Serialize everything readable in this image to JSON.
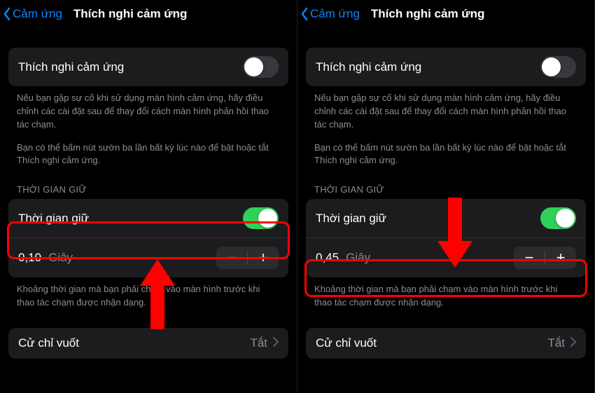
{
  "left": {
    "back_label": "Cảm ứng",
    "title": "Thích nghi cảm ứng",
    "touch_accom": {
      "label": "Thích nghi cảm ứng",
      "on": false
    },
    "desc1": "Nếu bạn gặp sự cố khi sử dụng màn hình cảm ứng, hãy điều chỉnh các cài đặt sau để thay đổi cách màn hình phản hồi thao tác chạm.",
    "desc2": "Bạn có thể bấm nút sườn ba lần bất kỳ lúc nào để bật hoặc tắt Thích nghi cảm ứng.",
    "hold_header": "THỜI GIAN GIỮ",
    "hold": {
      "label": "Thời gian giữ",
      "on": true,
      "value": "0,10",
      "unit": "Giây"
    },
    "hold_desc": "Khoảng thời gian mà bạn phải chạm vào màn hình trước khi thao tác chạm được nhận dạng.",
    "swipe": {
      "label": "Cử chỉ vuốt",
      "value": "Tắt"
    }
  },
  "right": {
    "back_label": "Cảm ứng",
    "title": "Thích nghi cảm ứng",
    "touch_accom": {
      "label": "Thích nghi cảm ứng",
      "on": false
    },
    "desc1": "Nếu bạn gặp sự cố khi sử dụng màn hình cảm ứng, hãy điều chỉnh các cài đặt sau để thay đổi cách màn hình phản hồi thao tác chạm.",
    "desc2": "Bạn có thể bấm nút sườn ba lần bất kỳ lúc nào để bật hoặc tắt Thích nghi cảm ứng.",
    "hold_header": "THỜI GIAN GIỮ",
    "hold": {
      "label": "Thời gian giữ",
      "on": true,
      "value": "0,45",
      "unit": "Giây"
    },
    "hold_desc": "Khoảng thời gian mà bạn phải chạm vào màn hình trước khi thao tác chạm được nhận dạng.",
    "swipe": {
      "label": "Cử chỉ vuốt",
      "value": "Tắt"
    }
  }
}
